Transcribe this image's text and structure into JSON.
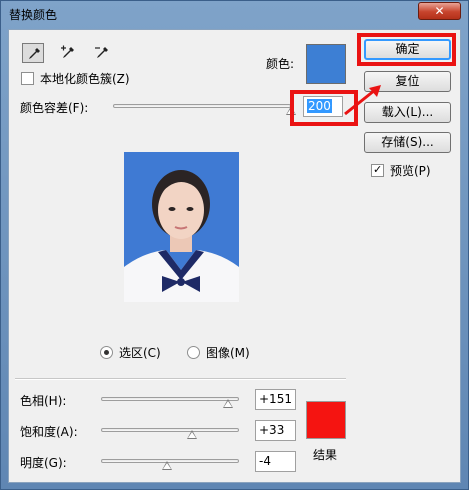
{
  "window": {
    "title": "替换颜色",
    "close_label": "✕"
  },
  "tools": [
    {
      "name": "eyedropper",
      "active": true
    },
    {
      "name": "eyedropper-plus",
      "active": false
    },
    {
      "name": "eyedropper-minus",
      "active": false
    }
  ],
  "localized": {
    "label": "本地化颜色簇(Z)",
    "checked": false
  },
  "color": {
    "label": "颜色:",
    "value": "#3d7fd4"
  },
  "fuzziness": {
    "label": "颜色容差(F):",
    "value": "200",
    "fraction": 1.0
  },
  "buttons": {
    "ok": "确定",
    "reset": "复位",
    "load": "载入(L)...",
    "save": "存储(S)..."
  },
  "preview": {
    "label": "预览(P)",
    "checked": true
  },
  "view": {
    "selection": "选区(C)",
    "image": "图像(M)",
    "selected": "selection"
  },
  "adjust": {
    "hue": {
      "label": "色相(H):",
      "value": "+151",
      "fraction": 0.92
    },
    "saturation": {
      "label": "饱和度(A):",
      "value": "+33",
      "fraction": 0.66
    },
    "lightness": {
      "label": "明度(G):",
      "value": "-4",
      "fraction": 0.48
    }
  },
  "result": {
    "label": "结果",
    "color": "#f51411"
  },
  "colors": {
    "accent": "#3399ff",
    "highlight_frame": "#ea1313"
  }
}
